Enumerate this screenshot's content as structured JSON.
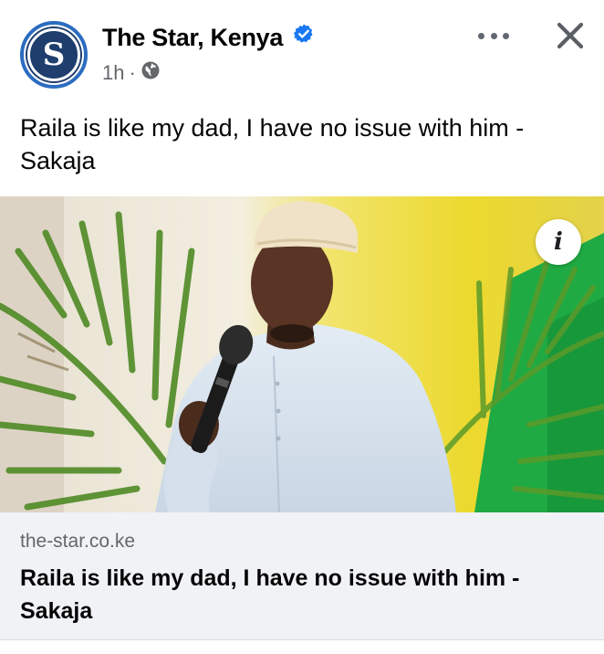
{
  "post": {
    "page_name": "The Star, Kenya",
    "avatar_letter": "S",
    "timestamp": "1h",
    "separator": "·",
    "audience_icon": "globe-icon",
    "verified_icon": "verified-badge-icon",
    "more_icon": "more-options-icon",
    "close_icon": "close-icon",
    "caption": "Raila is like my dad, I have no issue with him - Sakaja"
  },
  "image": {
    "subject": "Man in white kanzu and embroidered kofia speaking into a black microphone in front of palm fronds and a yellow, white and green backdrop",
    "info_icon": "info-icon",
    "info_glyph": "i"
  },
  "link_card": {
    "domain": "the-star.co.ke",
    "title": "Raila is like my dad, I have no issue with him - Sakaja"
  },
  "colors": {
    "brand_blue": "#2b6cc0",
    "verified_blue": "#1877f2",
    "secondary_text": "#65676b",
    "card_background": "#f0f2f5"
  }
}
